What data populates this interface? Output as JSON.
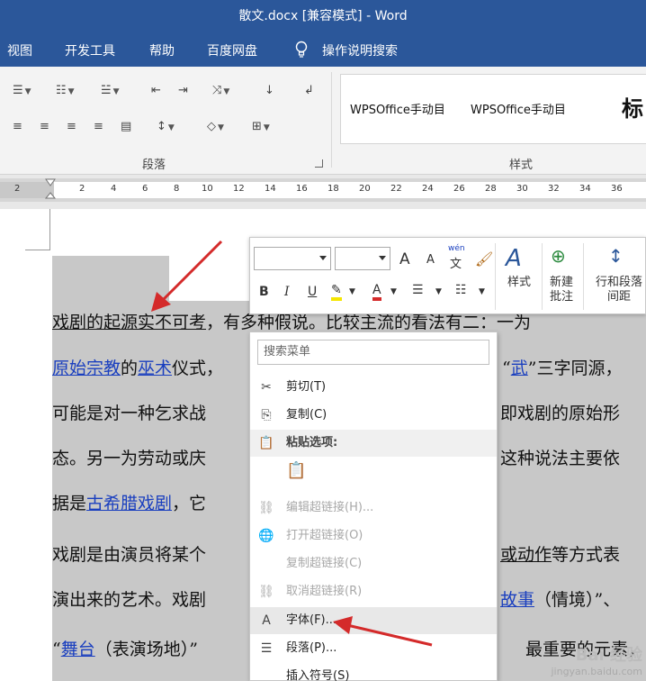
{
  "window": {
    "title": "散文.docx [兼容模式] - Word"
  },
  "menu": {
    "tabs": [
      "视图",
      "开发工具",
      "帮助",
      "百度网盘"
    ],
    "tell_me": "操作说明搜索"
  },
  "ribbon": {
    "paragraph_group": "段落",
    "styles_group": "样式",
    "styles": [
      "WPSOffice手动目",
      "WPSOffice手动目",
      "标"
    ]
  },
  "ruler": {
    "ticks": [
      "2",
      "2",
      "4",
      "6",
      "8",
      "10",
      "12",
      "14",
      "16",
      "18",
      "20",
      "22",
      "24",
      "26",
      "28",
      "30",
      "32",
      "34",
      "36"
    ]
  },
  "document": {
    "lines": [
      {
        "segments": [
          {
            "t": "戏剧的起源实不可考",
            "s": "ul"
          },
          {
            "t": "，有多种假说。比较主流的看法有二：一为",
            "s": ""
          }
        ]
      },
      {
        "segments": [
          {
            "t": "原始宗教",
            "s": "lnk"
          },
          {
            "t": "的",
            "s": ""
          },
          {
            "t": "巫术",
            "s": "lnk"
          },
          {
            "t": "仪式，",
            "s": ""
          }
        ]
      },
      {
        "segments": [
          {
            "t": "可能是对一种乞求战",
            "s": ""
          }
        ]
      },
      {
        "segments": [
          {
            "t": "态。另一为劳动或庆",
            "s": ""
          }
        ]
      },
      {
        "segments": [
          {
            "t": "据是",
            "s": ""
          },
          {
            "t": "古希腊戏剧",
            "s": "lnk"
          },
          {
            "t": "，它",
            "s": ""
          }
        ]
      },
      {
        "segments": [
          {
            "t": "戏剧是由演员将某个",
            "s": ""
          }
        ]
      },
      {
        "segments": [
          {
            "t": "演出来的艺术。戏剧",
            "s": ""
          }
        ]
      },
      {
        "segments": [
          {
            "t": "“",
            "s": ""
          },
          {
            "t": "舞台",
            "s": "lnk"
          },
          {
            "t": "（表演场地）”",
            "s": ""
          }
        ]
      }
    ],
    "right_fragments": [
      {
        "segments": [
          {
            "t": "“",
            "s": ""
          },
          {
            "t": "武",
            "s": "lnk"
          },
          {
            "t": "”三字同源，",
            "s": ""
          }
        ]
      },
      {
        "segments": [
          {
            "t": "即戏剧的原始形",
            "s": ""
          }
        ]
      },
      {
        "segments": [
          {
            "t": "这种说法主要依",
            "s": ""
          }
        ]
      },
      {
        "segments": [
          {
            "t": "或动作",
            "s": "ul"
          },
          {
            "t": "等方式表",
            "s": ""
          }
        ]
      },
      {
        "segments": [
          {
            "t": "故事",
            "s": "lnk"
          },
          {
            "t": "（情境）”、",
            "s": ""
          }
        ]
      },
      {
        "segments": [
          {
            "t": "最重要的元素，",
            "s": ""
          }
        ]
      }
    ]
  },
  "mini_toolbar": {
    "styles_label": "样式",
    "new_comment_label": "新建批注",
    "line_spacing_label": "行和段落间距",
    "bold": "B",
    "italic": "I",
    "underline": "U",
    "grow": "A",
    "shrink": "A",
    "wen": "wén",
    "wen_char": "文"
  },
  "context_menu": {
    "search_placeholder": "搜索菜单",
    "items": [
      {
        "label": "剪切(T)",
        "icon": "scissors-icon",
        "disabled": false
      },
      {
        "label": "复制(C)",
        "icon": "copy-icon",
        "disabled": false
      },
      {
        "label": "粘贴选项:",
        "icon": "paste-icon",
        "disabled": false,
        "header": true
      },
      {
        "label": "",
        "icon": "paste-text-only-icon",
        "disabled": false
      },
      {
        "label": "编辑超链接(H)...",
        "icon": "edit-link-icon",
        "disabled": true
      },
      {
        "label": "打开超链接(O)",
        "icon": "open-link-icon",
        "disabled": true
      },
      {
        "label": "复制超链接(C)",
        "icon": "",
        "disabled": true
      },
      {
        "label": "取消超链接(R)",
        "icon": "remove-link-icon",
        "disabled": true
      },
      {
        "label": "字体(F)...",
        "icon": "font-icon",
        "disabled": false,
        "hover": true
      },
      {
        "label": "段落(P)...",
        "icon": "paragraph-icon",
        "disabled": false
      },
      {
        "label": "插入符号(S)",
        "icon": "",
        "disabled": false
      }
    ]
  },
  "watermark": {
    "brand": "Bai 经验",
    "url": "jingyan.baidu.com"
  },
  "colors": {
    "word_blue": "#2b579a",
    "link": "#1a3fbf",
    "arrow": "#d42a2a",
    "highlight": "#c8c8c8"
  }
}
